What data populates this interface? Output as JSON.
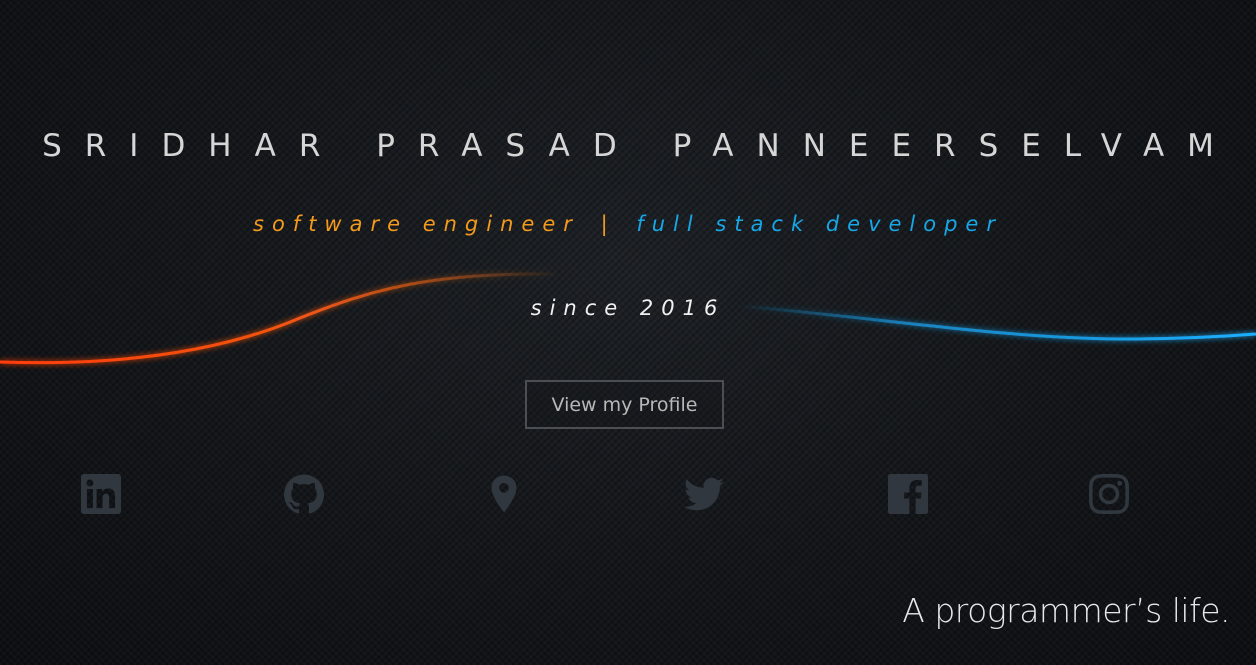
{
  "hero": {
    "name": "SRIDHAR PRASAD PANNEERSELVAM",
    "role_primary": "software engineer",
    "separator": "|",
    "role_secondary": "full stack developer",
    "since": "since 2016",
    "profile_button_label": "View my Profile",
    "signature": "A programmer’s life."
  },
  "social_links": [
    {
      "icon": "linkedin-icon"
    },
    {
      "icon": "github-icon"
    },
    {
      "icon": "location-pin-icon"
    },
    {
      "icon": "twitter-icon"
    },
    {
      "icon": "facebook-icon"
    },
    {
      "icon": "instagram-icon"
    }
  ],
  "colors": {
    "background": "#15181c",
    "accent_orange": "#f39a1c",
    "accent_blue": "#18a7e6",
    "wave_orange": "#ff4a12",
    "wave_blue": "#1aa3f0",
    "icon": "#30373f"
  }
}
